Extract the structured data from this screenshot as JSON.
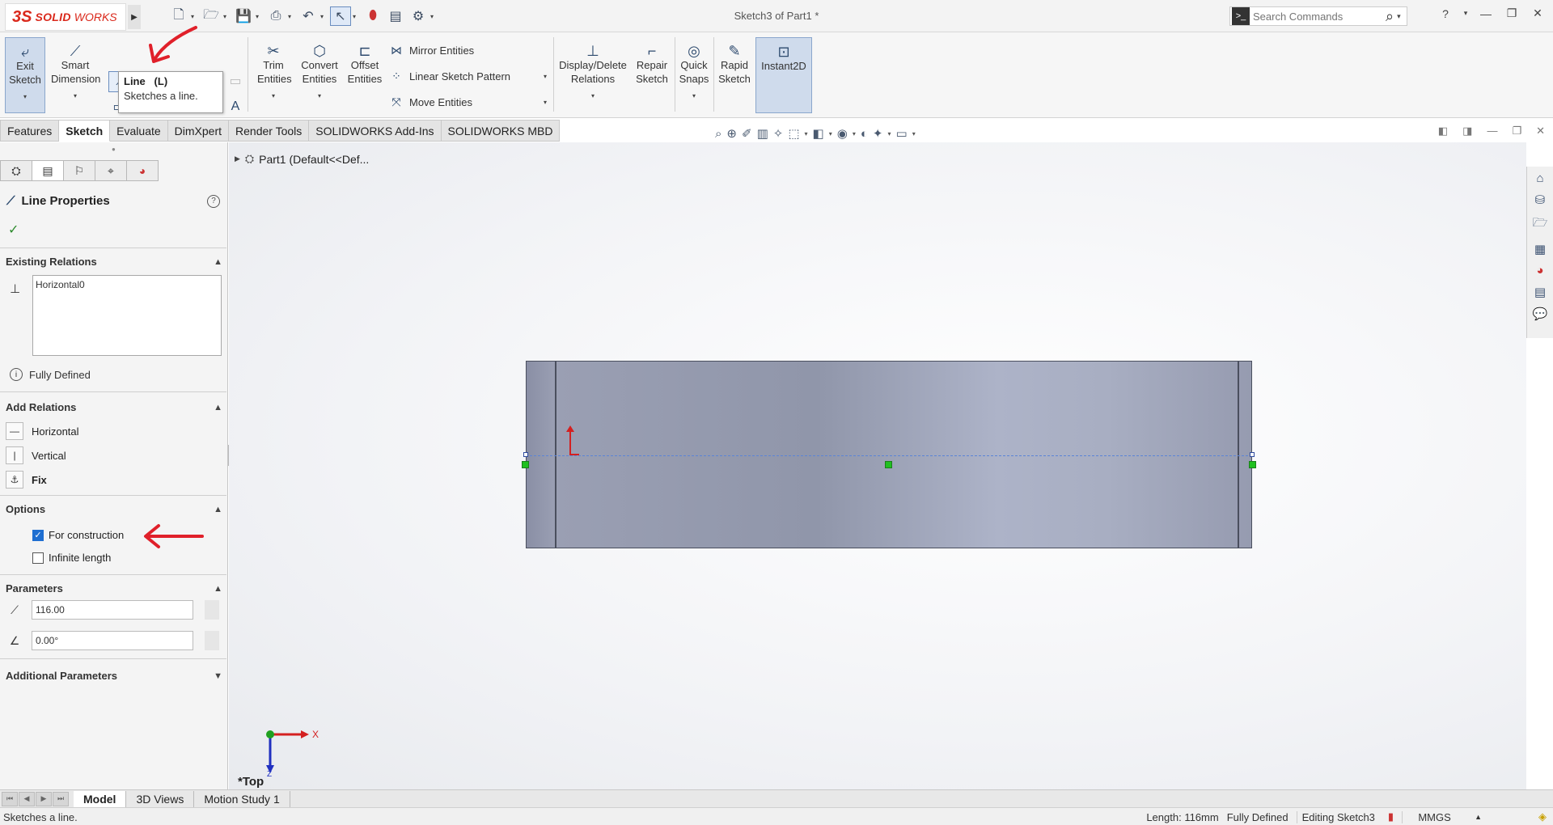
{
  "titlebar": {
    "logo_ds": "3S",
    "logo_solid": "SOLID",
    "logo_works": "WORKS",
    "window_title": "Sketch3 of Part1 *",
    "search_placeholder": "Search Commands",
    "help_label": "?"
  },
  "ribbon": {
    "exit_sketch": "Exit Sketch",
    "smart_dimension": "Smart Dimension",
    "trim_entities": "Trim Entities",
    "convert_entities": "Convert Entities",
    "offset_entities": "Offset Entities",
    "mirror_entities": "Mirror Entities",
    "linear_sketch_pattern": "Linear Sketch Pattern",
    "move_entities": "Move Entities",
    "display_delete_relations": "Display/Delete Relations",
    "repair_sketch": "Repair Sketch",
    "quick_snaps": "Quick Snaps",
    "rapid_sketch": "Rapid Sketch",
    "instant2d": "Instant2D"
  },
  "tooltip": {
    "title": "Line   (L)",
    "description": "Sketches a line."
  },
  "cm_tabs": [
    {
      "label": "Features"
    },
    {
      "label": "Sketch"
    },
    {
      "label": "Evaluate"
    },
    {
      "label": "DimXpert"
    },
    {
      "label": "Render Tools"
    },
    {
      "label": "SOLIDWORKS Add-Ins"
    },
    {
      "label": "SOLIDWORKS MBD"
    }
  ],
  "tree": {
    "part_label": "Part1  (Default<<Def..."
  },
  "property_manager": {
    "title": "Line Properties",
    "existing_relations": "Existing Relations",
    "relation_item": "Horizontal0",
    "status": "Fully Defined",
    "add_relations": "Add Relations",
    "rel_horizontal": "Horizontal",
    "rel_vertical": "Vertical",
    "rel_fix": "Fix",
    "options": "Options",
    "for_construction": "For construction",
    "for_construction_checked": true,
    "infinite_length": "Infinite length",
    "infinite_length_checked": false,
    "parameters": "Parameters",
    "length_value": "116.00",
    "angle_value": "0.00°",
    "additional_parameters": "Additional Parameters"
  },
  "viewport": {
    "view_label": "*Top",
    "triad_x": "X",
    "triad_z": "Z"
  },
  "bottom_tabs": [
    {
      "label": "Model"
    },
    {
      "label": "3D Views"
    },
    {
      "label": "Motion Study 1"
    }
  ],
  "status_bar": {
    "message": "Sketches a line.",
    "length": "Length: 116mm",
    "defined": "Fully Defined",
    "editing": "Editing Sketch3",
    "units": "MMGS"
  },
  "colors": {
    "brand_red": "#da291c",
    "accent_blue": "#1f6fd1",
    "part_gray": "#9096aa",
    "annotation_red": "#e0202a"
  }
}
